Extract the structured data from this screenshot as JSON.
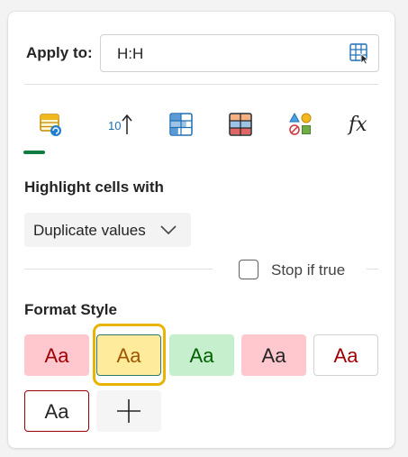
{
  "apply_to": {
    "label": "Apply to:",
    "range": "H:H",
    "picker_icon": "select-range-icon"
  },
  "rule_tabs": [
    {
      "name": "highlight-cells",
      "icon": "highlight-cells-icon",
      "selected": true
    },
    {
      "name": "top-bottom",
      "icon": "top-bottom-10-icon",
      "selected": false
    },
    {
      "name": "data-bars",
      "icon": "data-bars-icon",
      "selected": false
    },
    {
      "name": "color-scales",
      "icon": "color-scales-icon",
      "selected": false
    },
    {
      "name": "icon-sets",
      "icon": "icon-sets-icon",
      "selected": false
    },
    {
      "name": "formula",
      "icon": "formula-fx-icon",
      "selected": false
    }
  ],
  "highlight": {
    "title": "Highlight cells with",
    "selected_option": "Duplicate values"
  },
  "stop_if_true": {
    "label": "Stop if true",
    "checked": false
  },
  "format_style": {
    "title": "Format Style",
    "swatches": [
      {
        "label": "Aa",
        "bg": "#ffc7ce",
        "fg": "#9c0006",
        "border": "#ffc7ce",
        "selected": false
      },
      {
        "label": "Aa",
        "bg": "#ffeb9c",
        "fg": "#9c5700",
        "border": "#2b7a6b",
        "selected": true
      },
      {
        "label": "Aa",
        "bg": "#c6efce",
        "fg": "#006100",
        "border": "#c6efce",
        "selected": false
      },
      {
        "label": "Aa",
        "bg": "#ffc7ce",
        "fg": "#242424",
        "border": "#ffc7ce",
        "selected": false
      },
      {
        "label": "Aa",
        "bg": "#ffffff",
        "fg": "#9c0006",
        "border": "#d1d1d1",
        "selected": false
      },
      {
        "label": "Aa",
        "bg": "#ffffff",
        "fg": "#242424",
        "border": "#9c0006",
        "selected": false
      }
    ],
    "add_icon": "add-icon"
  },
  "colors": {
    "accent": "#107c41",
    "focus": "#e8b400"
  }
}
